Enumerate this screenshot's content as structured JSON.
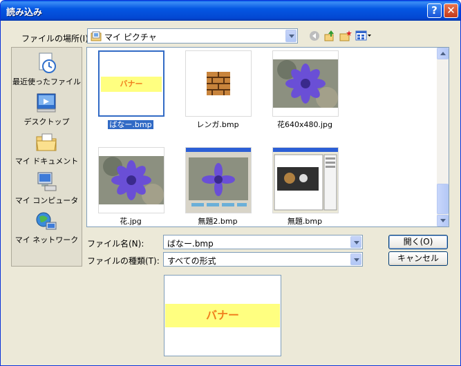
{
  "window": {
    "title": "読み込み",
    "help_label": "?",
    "close_label": "✕"
  },
  "location": {
    "label": "ファイルの場所(I):",
    "value": "マイ ピクチャ"
  },
  "places": [
    {
      "label": "最近使ったファイル",
      "icon": "recent-icon"
    },
    {
      "label": "デスクトップ",
      "icon": "desktop-icon"
    },
    {
      "label": "マイ ドキュメント",
      "icon": "documents-icon"
    },
    {
      "label": "マイ コンピュータ",
      "icon": "computer-icon"
    },
    {
      "label": "マイ ネットワーク",
      "icon": "network-icon"
    }
  ],
  "files": [
    {
      "name": "ばなー.bmp",
      "selected": true,
      "banner_text": "バナー"
    },
    {
      "name": "レンガ.bmp",
      "selected": false
    },
    {
      "name": "花640x480.jpg",
      "selected": false
    },
    {
      "name": "花.jpg",
      "selected": false
    },
    {
      "name": "無題2.bmp",
      "selected": false
    },
    {
      "name": "無題.bmp",
      "selected": false
    }
  ],
  "filename": {
    "label": "ファイル名(N):",
    "value": "ばなー.bmp"
  },
  "filetype": {
    "label": "ファイルの種類(T):",
    "value": "すべての形式"
  },
  "buttons": {
    "open": "開く(O)",
    "cancel": "キャンセル"
  },
  "preview": {
    "banner_text": "バナー"
  },
  "colors": {
    "titlebar": "#0458E3",
    "selection": "#316AC5",
    "banner_bg": "#FFFF80",
    "banner_text": "#F07F1E"
  }
}
